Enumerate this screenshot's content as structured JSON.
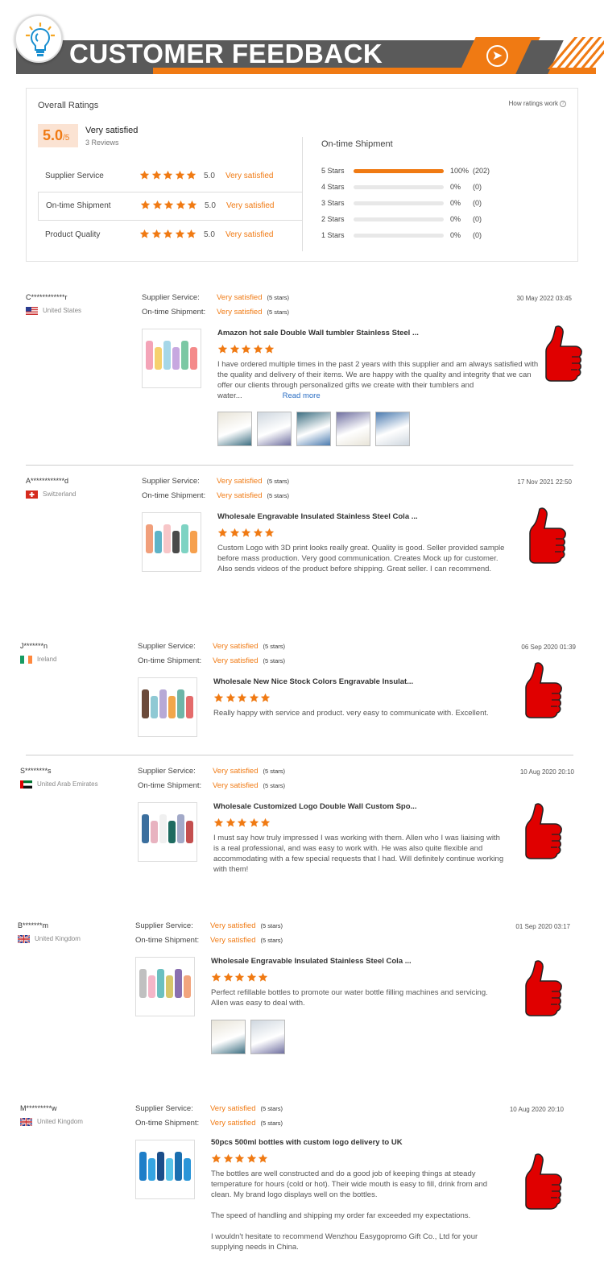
{
  "banner": {
    "title": "CUSTOMER FEEDBACK"
  },
  "overall": {
    "title": "Overall Ratings",
    "how_link": "How ratings work",
    "score": "5.0",
    "score_max": "/5",
    "score_label": "Very satisfied",
    "review_count": "3 Reviews",
    "categories": [
      {
        "name": "Supplier Service",
        "stars": 5,
        "score": "5.0",
        "label": "Very satisfied"
      },
      {
        "name": "On-time Shipment",
        "stars": 5,
        "score": "5.0",
        "label": "Very satisfied"
      },
      {
        "name": "Product Quality",
        "stars": 5,
        "score": "5.0",
        "label": "Very satisfied"
      }
    ],
    "shipment_title": "On-time Shipment",
    "histogram": [
      {
        "label": "5  Stars",
        "percent": 100,
        "pct_text": "100%",
        "count": "(202)"
      },
      {
        "label": "4  Stars",
        "percent": 0,
        "pct_text": "0%",
        "count": "(0)"
      },
      {
        "label": "3  Stars",
        "percent": 0,
        "pct_text": "0%",
        "count": "(0)"
      },
      {
        "label": "2  Stars",
        "percent": 0,
        "pct_text": "0%",
        "count": "(0)"
      },
      {
        "label": "1  Stars",
        "percent": 0,
        "pct_text": "0%",
        "count": "(0)"
      }
    ]
  },
  "labels": {
    "supplier_service": "Supplier Service:",
    "on_time_shipment": "On-time Shipment:",
    "very_satisfied": "Very satisfied",
    "five_stars": "(5 stars)",
    "read_more": "Read more"
  },
  "reviews": [
    {
      "user": "C************r",
      "country": "United States",
      "date": "30 May 2022 03:45",
      "product": "Amazon hot sale Double Wall tumbler Stainless Steel ...",
      "text": "I have ordered multiple times in the past 2 years with this supplier and am always satisfied with the quality and delivery of their items.  We are happy with the quality and integrity that we can offer our clients through personalized gifts we create with their tumblers and water...",
      "photos": 5
    },
    {
      "user": "A************d",
      "country": "Switzerland",
      "date": "17 Nov 2021 22:50",
      "product": "Wholesale Engravable Insulated Stainless Steel Cola ...",
      "text": "Custom Logo with 3D print looks really great. Quality is good. Seller provided sample before mass production. Very good communication. Creates Mock up for customer. Also sends videos of the product before shipping. Great seller. I can recommend.",
      "photos": 0
    },
    {
      "user": "J*******n",
      "country": "Ireland",
      "date": "06 Sep 2020 01:39",
      "product": "Wholesale New Nice Stock Colors Engravable Insulat...",
      "text": "Really happy with service and product. very easy to communicate with. Excellent.",
      "photos": 0
    },
    {
      "user": "S********s",
      "country": "United Arab Emirates",
      "date": "10 Aug 2020 20:10",
      "product": "Wholesale Customized Logo Double Wall Custom Spo...",
      "text": "I must say how truly impressed I was working with them. Allen who I was liaising with is a real professional, and was easy to work with. He was also quite flexible and accommodating with a few special requests that I had. Will definitely continue working with them!",
      "photos": 0
    },
    {
      "user": "B*******m",
      "country": "United Kingdom",
      "date": "01 Sep 2020 03:17",
      "product": "Wholesale Engravable Insulated Stainless Steel Cola ...",
      "text": "Perfect refillable bottles to promote our water bottle filling machines and servicing. Allen was easy to deal with.",
      "photos": 2
    },
    {
      "user": "M*********w",
      "country": "United Kingdom",
      "date": "10 Aug 2020 20:10",
      "product": "50pcs 500ml bottles with custom logo delivery to UK",
      "text_paras": [
        "The bottles are well constructed and do a good job of keeping things at steady temperature for hours (cold or hot). Their wide mouth is easy to fill, drink from and clean. My brand logo displays well on the bottles.",
        "The speed of handling and shipping my order far exceeded my expectations.",
        "I wouldn't hesitate to recommend Wenzhou Easygopromo Gift Co., Ltd for your supplying needs in China."
      ],
      "photos": 0
    }
  ],
  "colors": {
    "accent": "#f07a13",
    "banner_gray": "#5a5a5a",
    "thumb_red": "#e00000"
  }
}
